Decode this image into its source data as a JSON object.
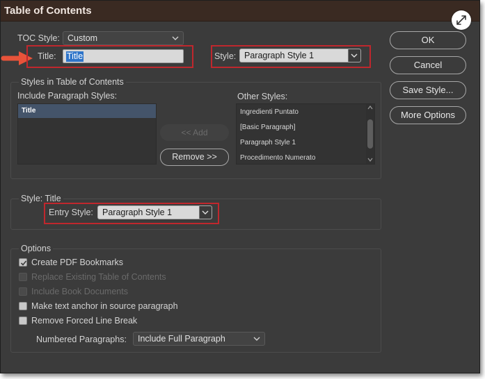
{
  "dialog": {
    "title": "Table of Contents"
  },
  "toc_style": {
    "label": "TOC Style:",
    "value": "Custom"
  },
  "title_field": {
    "label": "Title:",
    "value": "Title"
  },
  "style_field": {
    "label": "Style:",
    "value": "Paragraph Style 1"
  },
  "buttons": {
    "ok": "OK",
    "cancel": "Cancel",
    "save_style": "Save Style...",
    "more_options": "More Options"
  },
  "styles_group": {
    "title": "Styles in Table of Contents",
    "include_label": "Include Paragraph Styles:",
    "included": [
      "Title"
    ],
    "other_label": "Other Styles:",
    "other": [
      "Ingredienti Puntato",
      "[Basic Paragraph]",
      "Paragraph Style 1",
      "Procedimento Numerato"
    ],
    "add_label": "<< Add",
    "remove_label": "Remove >>"
  },
  "style_title_group": {
    "title": "Style: Title",
    "entry_label": "Entry Style:",
    "entry_value": "Paragraph Style 1"
  },
  "options_group": {
    "title": "Options",
    "items": [
      {
        "label": "Create PDF Bookmarks",
        "checked": true,
        "enabled": true
      },
      {
        "label": "Replace Existing Table of Contents",
        "checked": false,
        "enabled": false
      },
      {
        "label": "Include Book Documents",
        "checked": false,
        "enabled": false
      },
      {
        "label": "Make text anchor in source paragraph",
        "checked": false,
        "enabled": true
      },
      {
        "label": "Remove Forced Line Break",
        "checked": false,
        "enabled": true
      }
    ],
    "numbered_label": "Numbered Paragraphs:",
    "numbered_value": "Include Full Paragraph"
  },
  "colors": {
    "highlight_box": "#c0272d",
    "annotation_arrow": "#e8533a",
    "dialog_bg": "#3b3b3b",
    "titlebar_bg": "#3a2a22"
  }
}
